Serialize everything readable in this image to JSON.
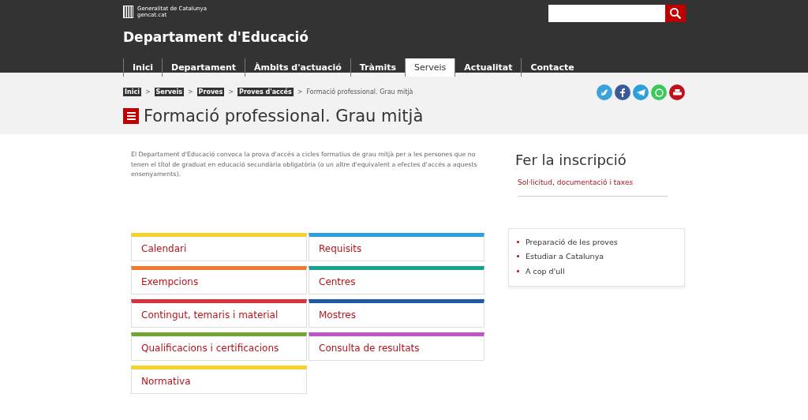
{
  "header": {
    "brand_line_1": "Generalitat de Catalunya",
    "brand_line_2": "gencat.cat",
    "site_title": "Departament d'Educació"
  },
  "nav": [
    {
      "label": "Inici",
      "selected": false
    },
    {
      "label": "Departament",
      "selected": false
    },
    {
      "label": "Àmbits d'actuació",
      "selected": false
    },
    {
      "label": "Tràmits",
      "selected": false
    },
    {
      "label": "Serveis",
      "selected": true
    },
    {
      "label": "Actualitat",
      "selected": false
    },
    {
      "label": "Contacte",
      "selected": false
    }
  ],
  "breadcrumb": [
    {
      "label": "Inici",
      "kind": "link"
    },
    {
      "separator": ">",
      "label": "Serveis",
      "kind": "link"
    },
    {
      "separator": ">",
      "label": "Proves",
      "kind": "link"
    },
    {
      "separator": ">",
      "label": "Proves d'accés",
      "kind": "link"
    },
    {
      "separator": ">",
      "label": "Formació professional. Grau mitjà",
      "kind": "current"
    }
  ],
  "share": [
    {
      "kind": "twitter"
    },
    {
      "kind": "facebook"
    },
    {
      "kind": "telegram"
    },
    {
      "kind": "whatsapp"
    },
    {
      "kind": "print"
    }
  ],
  "page_title": "Formació professional. Grau mitjà",
  "intro": "El Departament d'Educació convoca la prova d'accés a cicles formatius de grau mitjà per a les persones que no tenen el títol de graduat en educació secundària obligatòria (o un altre d'equivalent a efectes d'accés a aquests ensenyaments).",
  "tiles": [
    {
      "label": "Calendari",
      "color": "#f5d22b"
    },
    {
      "label": "Requisits",
      "color": "#2f9ee0"
    },
    {
      "label": "Exempcions",
      "color": "#f07b2c"
    },
    {
      "label": "Centres",
      "color": "#15a38b"
    },
    {
      "label": "Contingut, temaris i material",
      "color": "#d9323a"
    },
    {
      "label": "Mostres",
      "color": "#1c5aa6"
    },
    {
      "label": "Qualificacions i certificacions",
      "color": "#6ea72f"
    },
    {
      "label": "Consulta de resultats",
      "color": "#c054c9"
    },
    {
      "label": "Normativa",
      "color": "#f5d22b"
    }
  ],
  "sidebar": {
    "heading": "Fer la inscripció",
    "link": "Sol·licitud, documentació i taxes",
    "related": [
      "Preparació de les proves",
      "Estudiar a Catalunya",
      "A cop d'ull"
    ]
  }
}
